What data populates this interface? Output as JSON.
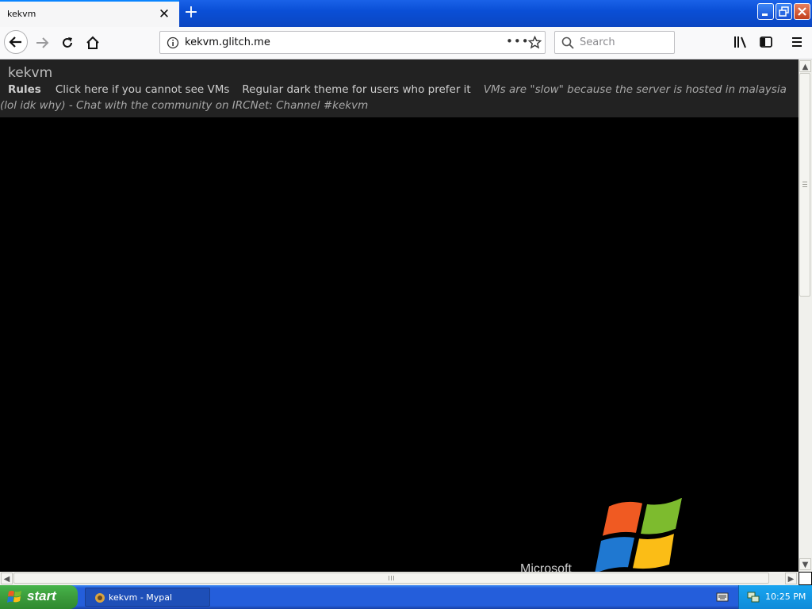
{
  "browser": {
    "tab": {
      "title": "kekvm"
    },
    "url": "kekvm.glitch.me",
    "search_placeholder": "Search"
  },
  "page": {
    "site_title": "kekvm",
    "nav_links": [
      "Rules",
      "Click here if you cannot see VMs",
      "Regular dark theme for users who prefer it"
    ],
    "notice": "VMs are \"slow\" because the server is hosted in malaysia (lol idk why) - Chat with the community on IRCNet: Channel #kekvm"
  },
  "taskbar": {
    "start_label": "start",
    "task_item": "kekvm - Mypal",
    "clock": "10:25 PM"
  },
  "colors": {
    "page_header_bg": "#222222",
    "titlebar_blue": "#0b4fd6",
    "start_green": "#3c9c3c"
  }
}
